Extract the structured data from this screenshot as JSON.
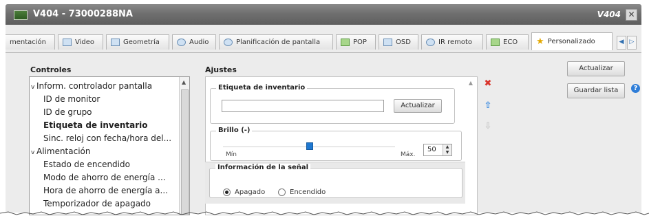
{
  "window": {
    "title": "V404 - 73000288NA",
    "model": "V404",
    "close_glyph": "✕"
  },
  "tabs": [
    {
      "label": "mentación",
      "icon": ""
    },
    {
      "label": "Video",
      "icon": "video-icon"
    },
    {
      "label": "Geometría",
      "icon": "geometry-icon"
    },
    {
      "label": "Audio",
      "icon": "audio-icon"
    },
    {
      "label": "Planificación de pantalla",
      "icon": "clock-icon"
    },
    {
      "label": "POP",
      "icon": "pop-icon"
    },
    {
      "label": "OSD",
      "icon": "osd-icon"
    },
    {
      "label": "IR remoto",
      "icon": "ir-remote-icon"
    },
    {
      "label": "ECO",
      "icon": "eco-icon"
    },
    {
      "label": "Personalizado",
      "icon": "star-icon",
      "active": true
    }
  ],
  "controls": {
    "title": "Controles",
    "items": [
      {
        "label": "Inform. controlador pantalla",
        "type": "group"
      },
      {
        "label": "ID de monitor",
        "type": "child"
      },
      {
        "label": "ID de grupo",
        "type": "child"
      },
      {
        "label": "Etiqueta de inventario",
        "type": "child",
        "selected": true
      },
      {
        "label": "Sinc. reloj con fecha/hora del...",
        "type": "child"
      },
      {
        "label": "Alimentación",
        "type": "group"
      },
      {
        "label": "Estado de encendido",
        "type": "child"
      },
      {
        "label": "Modo de ahorro de energía ...",
        "type": "child"
      },
      {
        "label": "Hora de ahorro de energía a...",
        "type": "child"
      },
      {
        "label": "Temporizador de apagado",
        "type": "child"
      }
    ]
  },
  "ajustes": {
    "title": "Ajustes",
    "asset_tag": {
      "legend": "Etiqueta de inventario",
      "value": "",
      "button": "Actualizar"
    },
    "brightness": {
      "legend": "Brillo (-)",
      "min_label": "Mín",
      "max_label": "Máx.",
      "value": "50",
      "level": 0.5
    },
    "signal": {
      "legend": "Información de la señal",
      "options": [
        {
          "label": "Apagado",
          "checked": true
        },
        {
          "label": "Encendido",
          "checked": false
        }
      ]
    }
  },
  "actions": {
    "update": "Actualizar",
    "save_list": "Guardar lista",
    "help": "?"
  },
  "colors": {
    "accent": "#1f78d1",
    "titlebar": "#6f6f6f",
    "delete": "#d9342b"
  }
}
